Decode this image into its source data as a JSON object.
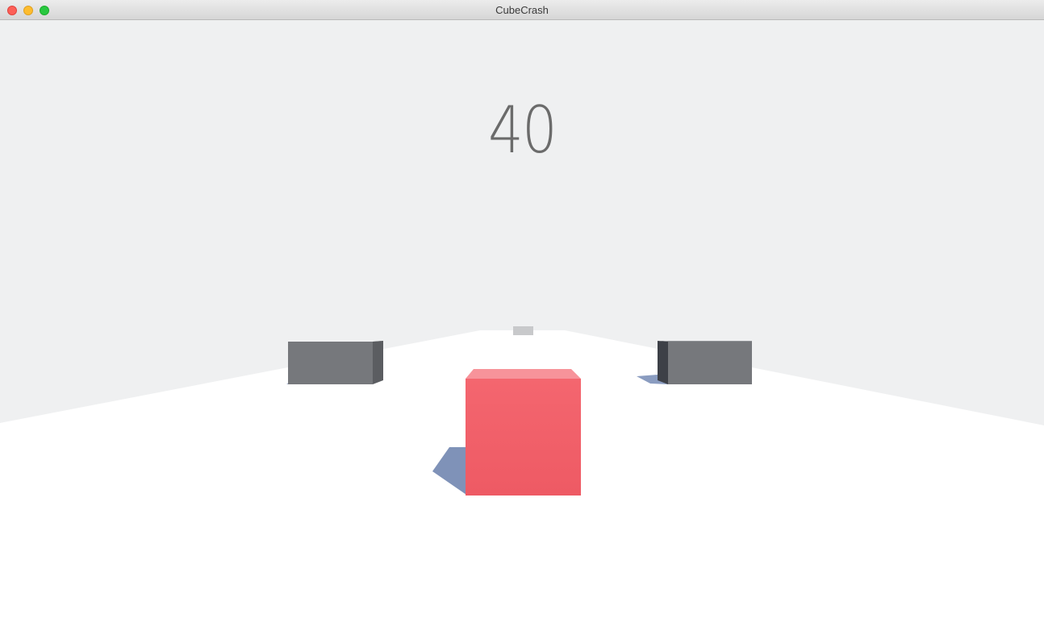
{
  "window": {
    "title": "CubeCrash"
  },
  "hud": {
    "score": "40"
  },
  "scene": {
    "sky_color": "#eff0f1",
    "floor_color": "#ffffff",
    "player_cube_color": "#f0606a",
    "obstacle_color": "#7a7c80",
    "shadow_color": "#7f92b8"
  }
}
